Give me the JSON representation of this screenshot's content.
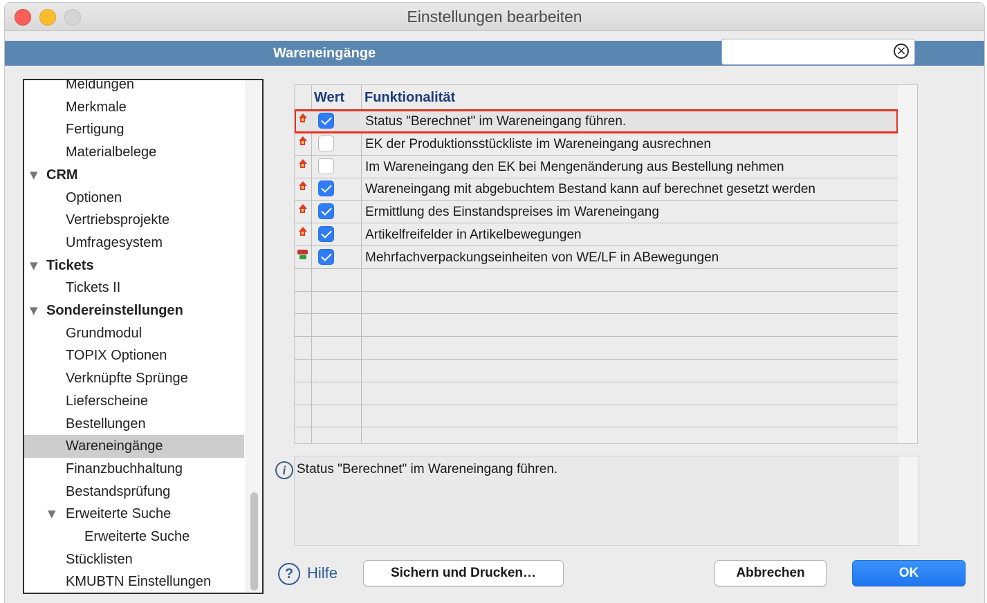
{
  "window": {
    "title": "Einstellungen bearbeiten"
  },
  "section": {
    "title": "Wareneingänge"
  },
  "search": {
    "value": "",
    "placeholder": ""
  },
  "sidebar": {
    "items": [
      {
        "label": "Meldungen",
        "level": 1
      },
      {
        "label": "Merkmale",
        "level": 1
      },
      {
        "label": "Fertigung",
        "level": 1
      },
      {
        "label": "Materialbelege",
        "level": 1
      },
      {
        "label": "CRM",
        "level": 0,
        "expanded": true
      },
      {
        "label": "Optionen",
        "level": 1
      },
      {
        "label": "Vertriebsprojekte",
        "level": 1
      },
      {
        "label": "Umfragesystem",
        "level": 1
      },
      {
        "label": "Tickets",
        "level": 0,
        "expanded": true
      },
      {
        "label": "Tickets II",
        "level": 1
      },
      {
        "label": "Sondereinstellungen",
        "level": 0,
        "expanded": true
      },
      {
        "label": "Grundmodul",
        "level": 1
      },
      {
        "label": "TOPIX Optionen",
        "level": 1
      },
      {
        "label": "Verknüpfte Sprünge",
        "level": 1
      },
      {
        "label": "Lieferscheine",
        "level": 1
      },
      {
        "label": "Bestellungen",
        "level": 1
      },
      {
        "label": "Wareneingänge",
        "level": 1,
        "selected": true
      },
      {
        "label": "Finanzbuchhaltung",
        "level": 1
      },
      {
        "label": "Bestandsprüfung",
        "level": 1
      },
      {
        "label": "Erweiterte Suche",
        "level": 1,
        "expanded": true
      },
      {
        "label": "Erweiterte Suche",
        "level": 2
      },
      {
        "label": "Stücklisten",
        "level": 1
      },
      {
        "label": "KMUBTN Einstellungen",
        "level": 1
      }
    ]
  },
  "table": {
    "headers": {
      "value": "Wert",
      "function": "Funktionalität"
    },
    "rows": [
      {
        "icon": "house-up-icon",
        "checked": true,
        "label": "Status \"Berechnet\" im Wareneingang führen.",
        "highlighted": true
      },
      {
        "icon": "house-up-icon",
        "checked": false,
        "label": "EK der Produktionsstückliste im Wareneingang ausrechnen"
      },
      {
        "icon": "house-up-icon",
        "checked": false,
        "label": "Im Wareneingang den EK bei Mengenänderung aus Bestellung nehmen"
      },
      {
        "icon": "house-up-icon",
        "checked": true,
        "label": "Wareneingang mit abgebuchtem Bestand kann auf berechnet gesetzt werden"
      },
      {
        "icon": "house-up-icon",
        "checked": true,
        "label": "Ermittlung des Einstandspreises im Wareneingang"
      },
      {
        "icon": "house-up-icon",
        "checked": true,
        "label": "Artikelfreifelder in Artikelbewegungen"
      },
      {
        "icon": "multi-package-icon",
        "checked": true,
        "label": "Mehrfachverpackungseinheiten von WE/LF in ABewegungen"
      }
    ],
    "empty_rows": 8
  },
  "description": {
    "text": "Status \"Berechnet\" im Wareneingang führen."
  },
  "footer": {
    "help_label": "Hilfe",
    "save_print_label": "Sichern und Drucken…",
    "cancel_label": "Abbrechen",
    "ok_label": "OK"
  },
  "colors": {
    "header_bar": "#5a86b2",
    "checkbox_on": "#2f7cf6",
    "highlight_border": "#e8321e",
    "primary_button": "#1f76ef"
  }
}
